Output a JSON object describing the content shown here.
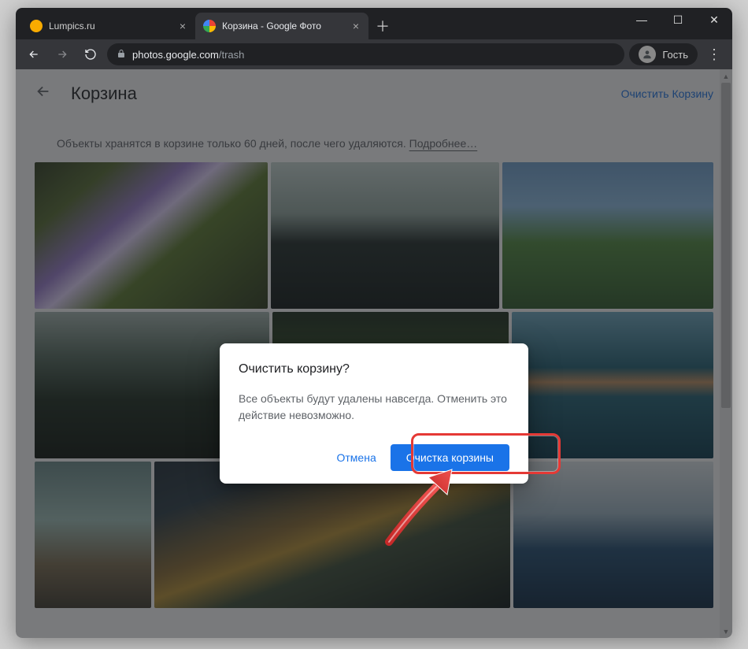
{
  "browser": {
    "tabs": [
      {
        "title": "Lumpics.ru"
      },
      {
        "title": "Корзина - Google Фото"
      }
    ],
    "win_min": "—",
    "win_max": "☐",
    "win_close": "✕",
    "newtab": "＋",
    "url_host": "photos.google.com",
    "url_path": "/trash",
    "guest_label": "Гость",
    "menu": "⋮"
  },
  "page": {
    "title": "Корзина",
    "empty_link": "Очистить Корзину",
    "notice_text": "Объекты хранятся в корзине только 60 дней, после чего удаляются. ",
    "notice_link": "Подробнее…"
  },
  "dialog": {
    "title": "Очистить корзину?",
    "body": "Все объекты будут удалены навсегда. Отменить это действие невозможно.",
    "cancel": "Отмена",
    "confirm": "Очистка корзины"
  }
}
